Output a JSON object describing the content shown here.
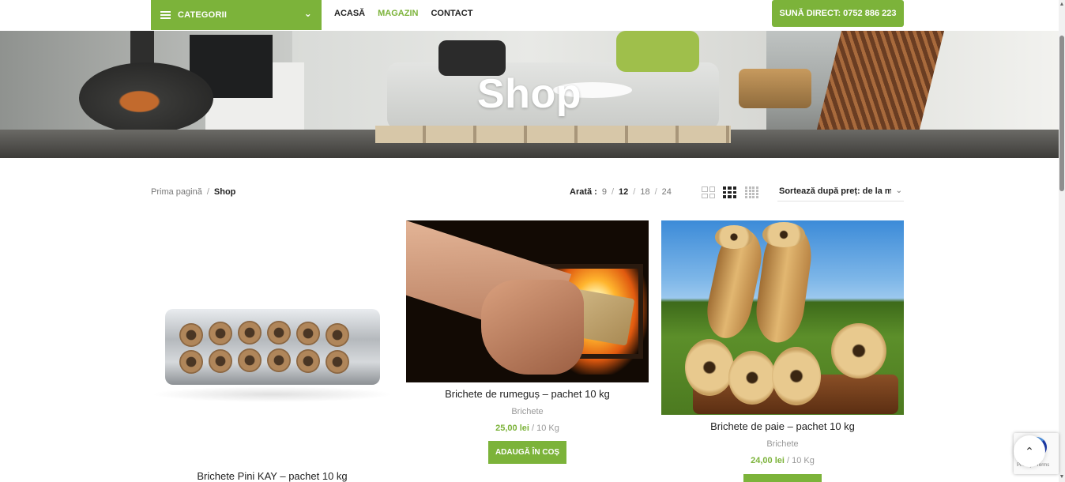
{
  "header": {
    "categories_label": "CATEGORII",
    "nav": [
      {
        "label": "ACASĂ",
        "active": false
      },
      {
        "label": "MAGAZIN",
        "active": true
      },
      {
        "label": "CONTACT",
        "active": false
      }
    ],
    "call_label": "SUNĂ DIRECT: 0752 886 223",
    "accent_color": "#7cb33a"
  },
  "hero": {
    "title": "Shop"
  },
  "breadcrumb": {
    "home": "Prima pagină",
    "separator": "/",
    "current": "Shop"
  },
  "toolbar": {
    "show_label": "Arată :",
    "per_page": [
      "9",
      "12",
      "18",
      "24"
    ],
    "per_page_active": "12",
    "separator": "/",
    "view_icons": [
      "grid-2-icon",
      "grid-3-icon",
      "grid-4-icon"
    ],
    "sort_label": "Sortează după preț: de la mic la mare"
  },
  "products": [
    {
      "name": "Brichete Pini KAY – pachet 10 kg",
      "category": "",
      "price": "",
      "unit": "",
      "button": ""
    },
    {
      "name": "Brichete de rumeguș – pachet 10 kg",
      "category": "Brichete",
      "price": "25,00 lei",
      "unit": "/ 10 Kg",
      "button": "ADAUGĂ ÎN COȘ"
    },
    {
      "name": "Brichete de paie – pachet 10 kg",
      "category": "Brichete",
      "price": "24,00 lei",
      "unit": "/ 10 Kg",
      "button": ""
    }
  ],
  "recaptcha": {
    "text": "Privacy - Terms"
  },
  "icons": {
    "menu": "hamburger-icon",
    "chevron": "chevron-down-icon",
    "back_to_top": "chevron-up-icon"
  }
}
